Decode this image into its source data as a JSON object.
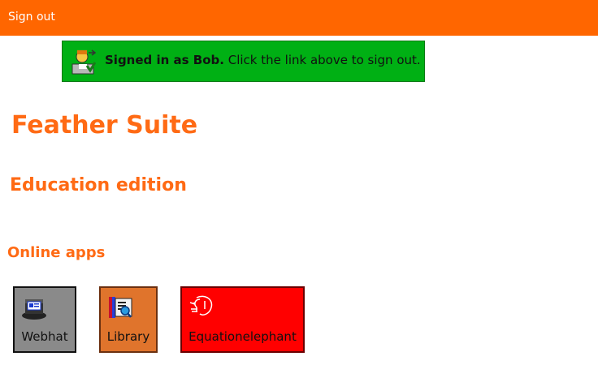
{
  "topbar": {
    "sign_out_label": "Sign out",
    "color": "#ff6600"
  },
  "banner": {
    "bold_text": "Signed in as Bob.",
    "text": " Click the link above to sign out.",
    "icon": "signed-in-user-icon",
    "color": "#00b014"
  },
  "page": {
    "title": "Feather Suite",
    "subtitle": "Education edition",
    "section_heading": "Online apps",
    "accent_color": "#ff6a14"
  },
  "apps": [
    {
      "label": "Webhat",
      "icon": "webhat-icon",
      "color": "#8a8a8a"
    },
    {
      "label": "Library",
      "icon": "library-icon",
      "color": "#e0742c"
    },
    {
      "label": "Equationelephant",
      "icon": "equationelephant-icon",
      "color": "#ff0000"
    }
  ]
}
